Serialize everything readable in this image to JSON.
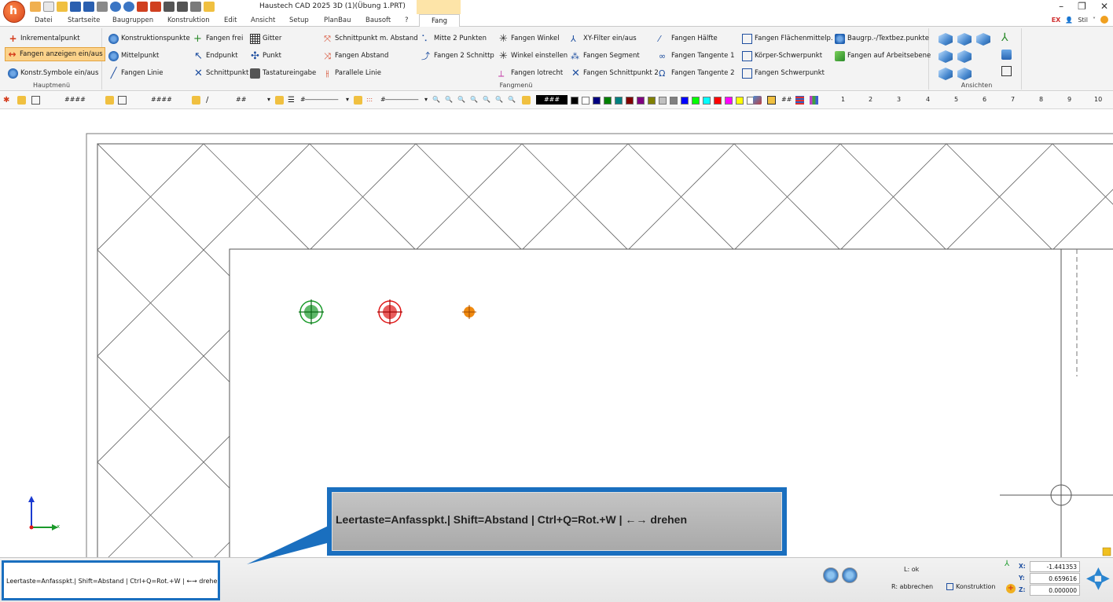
{
  "window": {
    "title": "Haustech CAD 2025 3D (1)(Übung 1.PRT)",
    "context_tab_color": "#fde4a8"
  },
  "tabs": [
    "Datei",
    "Startseite",
    "Baugruppen",
    "Konstruktion",
    "Edit",
    "Ansicht",
    "Setup",
    "PlanBau",
    "Bausoft",
    "?"
  ],
  "active_tab": "Fang",
  "tab_right": {
    "badge": "EX",
    "style_label": "Stil"
  },
  "groups": {
    "hauptmenu": {
      "label": "Hauptmenü",
      "items": [
        "Inkrementalpunkt",
        "Fangen anzeigen ein/aus",
        "Konstr.Symbole ein/aus"
      ]
    },
    "fangmenu": {
      "label": "Fangmenü",
      "col1": [
        "Konstruktionspunkte",
        "Mittelpunkt",
        "Fangen Linie"
      ],
      "col2": [
        "Fangen frei",
        "Endpunkt",
        "Schnittpunkt"
      ],
      "col3": [
        "Gitter",
        "Punkt",
        "Tastatureingabe"
      ],
      "col4": [
        "Schnittpunkt m. Abstand",
        "Fangen Abstand",
        "Parallele Linie"
      ],
      "col5": [
        "Mitte 2 Punkten",
        "Fangen 2 Schnittp"
      ],
      "col6": [
        "Fangen Winkel",
        "Winkel einstellen",
        "Fangen lotrecht"
      ],
      "col7": [
        "XY-Filter ein/aus",
        "Fangen Segment",
        "Fangen Schnittpunkt 2"
      ],
      "col8": [
        "Fangen Hälfte",
        "Fangen Tangente 1",
        "Fangen Tangente 2"
      ],
      "col9": [
        "Fangen Flächenmittelp.",
        "Körper-Schwerpunkt",
        "Fangen Schwerpunkt"
      ],
      "col10": [
        "Baugrp.-/Textbez.punkte",
        "Fangen auf Arbeitsebene"
      ]
    },
    "ansichten": {
      "label": "Ansichten"
    }
  },
  "toolbar": {
    "hash4a": "####",
    "hash4b": "####",
    "hash2": "##",
    "hash3": "###",
    "hash2b": "##",
    "layers": [
      "1",
      "2",
      "3",
      "4",
      "5",
      "6",
      "7",
      "8",
      "9",
      "10"
    ],
    "colors": [
      "#000000",
      "#ffffff",
      "#000080",
      "#008000",
      "#008080",
      "#800000",
      "#800080",
      "#808000",
      "#c0c0c0",
      "#808080",
      "#0000ff",
      "#00ff00",
      "#00ffff",
      "#ff0000",
      "#ff00ff",
      "#ffff00",
      "#ffffff"
    ]
  },
  "canvas": {
    "axis_label": "x",
    "snap_colors": [
      "#1a9a2a",
      "#e01818",
      "#f08a10"
    ]
  },
  "tooltip": {
    "text": "Leertaste=Anfasspkt.| Shift=Abstand | Ctrl+Q=Rot.+W | ←→ drehen"
  },
  "status": {
    "hint": "Leertaste=Anfasspkt.| Shift=Abstand | Ctrl+Q=Rot.+W | ←→ drehen",
    "l_label": "L: ok",
    "r_label": "R: abbrechen",
    "mode": "Konstruktion",
    "coords": {
      "x_label": "X:",
      "y_label": "Y:",
      "z_label": "Z:",
      "x": "-1.441353",
      "y": "0.659616",
      "z": "0.000000"
    }
  }
}
